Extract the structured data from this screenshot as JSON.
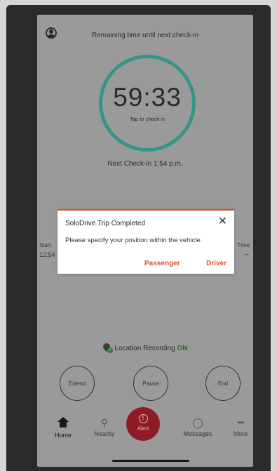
{
  "header": {
    "remaining_text": "Remaining time until next check-in"
  },
  "timer": {
    "countdown": "59:33",
    "tap_hint": "Tap to check in",
    "next_checkin": "Next Check-in 1:54 p.m."
  },
  "trip_info": {
    "start_label": "Start",
    "start_value": "12:54",
    "start_value_line2": ":",
    "time_label": "Time",
    "time_value": "--"
  },
  "location": {
    "label": "Location Recording",
    "status": "ON"
  },
  "actions": {
    "extend": "Extend",
    "pause": "Pause",
    "end": "End"
  },
  "tabs": [
    {
      "label": "Home",
      "icon": "home-icon"
    },
    {
      "label": "Nearby",
      "icon": "nearby-pin-icon"
    },
    {
      "label": "Alert",
      "icon": "alert-icon"
    },
    {
      "label": "Messages",
      "icon": "chat-bubble-icon"
    },
    {
      "label": "More",
      "icon": "more-dots-icon"
    }
  ],
  "dialog": {
    "title": "SoloDrive Trip Completed",
    "message": "Please specify your position within the vehicle.",
    "passenger": "Passenger",
    "driver": "Driver",
    "close_icon": "close-icon"
  },
  "colors": {
    "accent": "#d9532b",
    "ring": "#36948a",
    "alert": "#8e1c26",
    "on_status": "#1f6a2a"
  }
}
